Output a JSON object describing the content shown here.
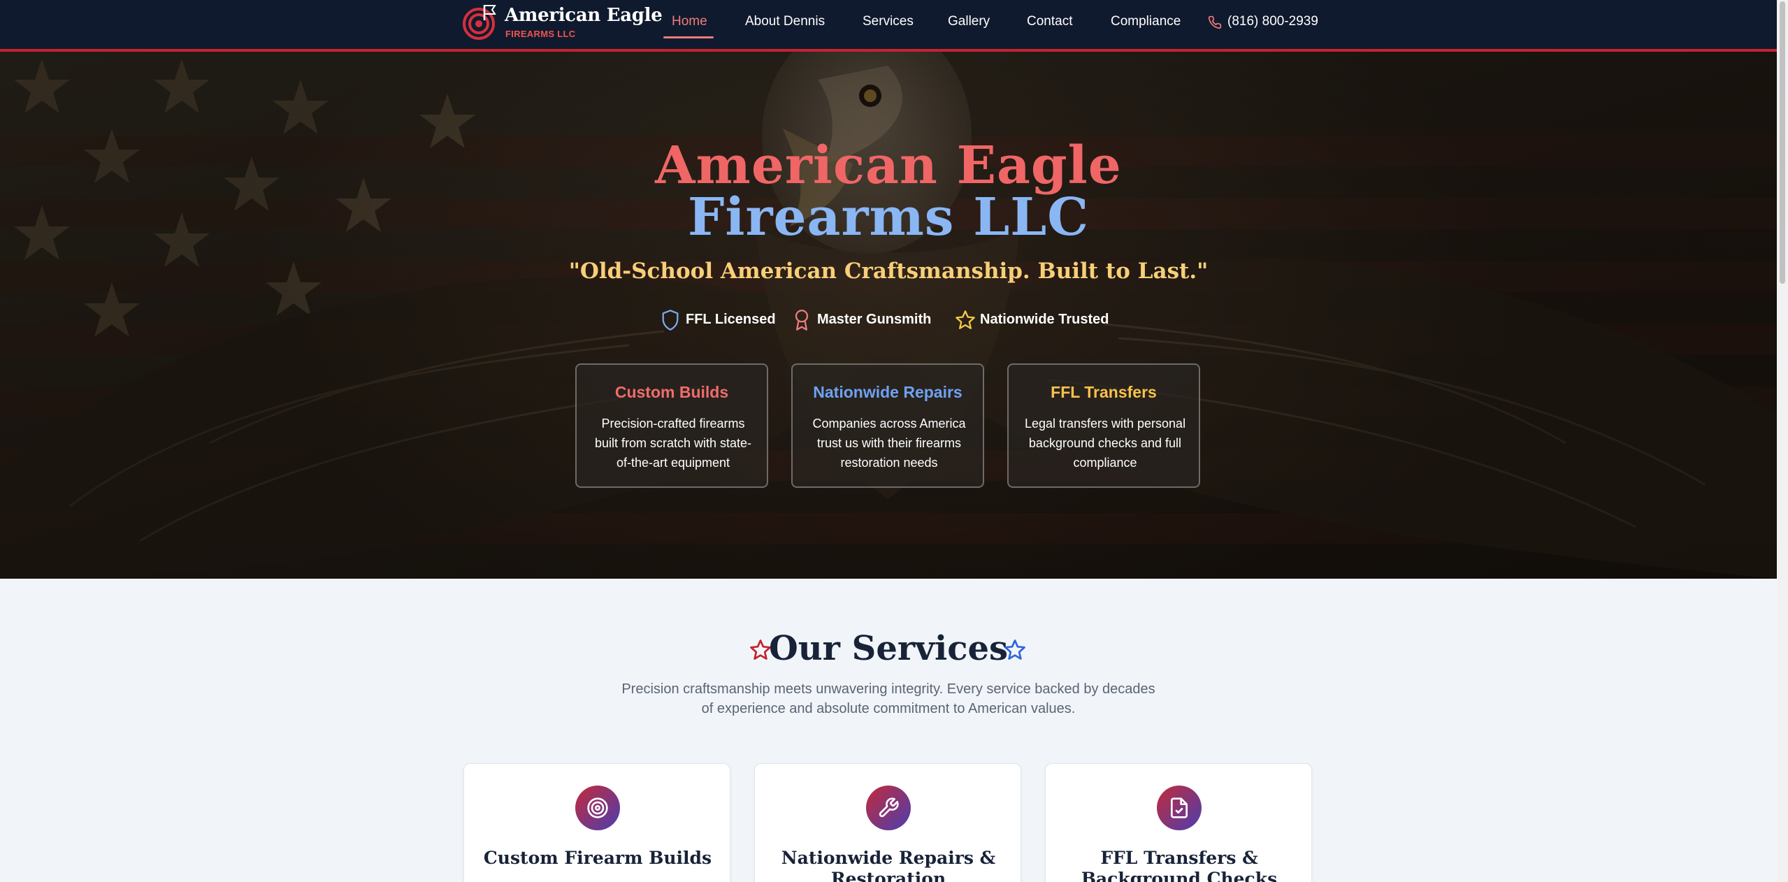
{
  "nav": {
    "brand_title": "American Eagle",
    "brand_subtitle": "FIREARMS LLC",
    "links": [
      "Home",
      "About Dennis",
      "Services",
      "Gallery",
      "Contact",
      "Compliance"
    ],
    "active": "Home",
    "phone": "(816) 800-2939",
    "icons": [
      "target-flag-logo-icon",
      "phone-icon"
    ]
  },
  "hero": {
    "title_line1": "American Eagle",
    "title_line2": "Firearms LLC",
    "tagline": "\"Old-School American Craftsmanship. Built to Last.\"",
    "badges": [
      {
        "label": "FFL Licensed",
        "icon": "shield-icon",
        "color": "#7aa8ee"
      },
      {
        "label": "Master Gunsmith",
        "icon": "award-icon",
        "color": "#f07b7b"
      },
      {
        "label": "Nationwide Trusted",
        "icon": "star-icon",
        "color": "#f7c948"
      }
    ],
    "cards": [
      {
        "title": "Custom Builds",
        "color": "#f06c6c",
        "description": "Precision-crafted firearms built from scratch with state-of-the-art equipment"
      },
      {
        "title": "Nationwide Repairs",
        "color": "#6ea2f2",
        "description": "Companies across America trust us with their firearms restoration needs"
      },
      {
        "title": "FFL Transfers",
        "color": "#f7c14c",
        "description": "Legal transfers with personal background checks and full compliance"
      }
    ]
  },
  "services": {
    "title": "Our Services",
    "subtitle": "Precision craftsmanship meets unwavering integrity. Every service backed by decades of experience and absolute commitment to American values.",
    "cards": [
      {
        "title": "Custom Firearm Builds",
        "icon": "target-icon"
      },
      {
        "title": "Nationwide Repairs & Restoration",
        "icon": "wrench-icon"
      },
      {
        "title": "FFL Transfers & Background Checks",
        "icon": "file-check-icon"
      }
    ]
  },
  "colors": {
    "nav_bg": "#101a2e",
    "accent_red": "#c5232f",
    "title_red": "#f06666",
    "title_blue": "#8ab6f4",
    "tagline_gold": "#f7cf78",
    "section_bg": "#f1f5f9"
  }
}
